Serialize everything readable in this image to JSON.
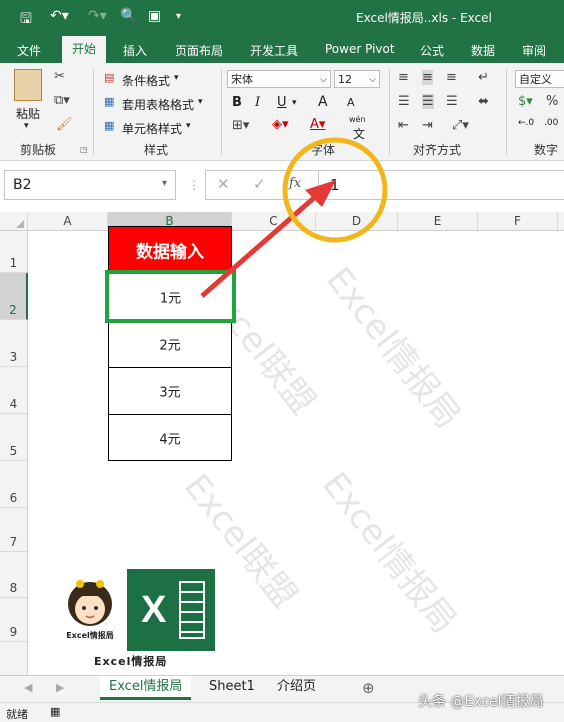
{
  "titlebar": {
    "title": "Excel情报局..xls  -  Excel"
  },
  "tabs": [
    "文件",
    "开始",
    "插入",
    "页面布局",
    "开发工具",
    "Power Pivot",
    "公式",
    "数据",
    "审阅"
  ],
  "ribbon": {
    "clipboard": {
      "paste": "粘贴",
      "label": "剪贴板"
    },
    "styles": {
      "conditional": "条件格式",
      "table_format": "套用表格格式",
      "cell_style": "单元格样式",
      "label": "样式"
    },
    "font": {
      "name": "宋体",
      "size": "12",
      "bold": "B",
      "italic": "I",
      "underline": "U",
      "grow": "A",
      "shrink": "A",
      "wen": "wén",
      "label": "字体"
    },
    "alignment": {
      "label": "对齐方式"
    },
    "number": {
      "format": "自定义",
      "label": "数字"
    }
  },
  "formula_bar": {
    "name_box": "B2",
    "fx": "fx",
    "value": "1"
  },
  "columns": [
    "A",
    "B",
    "C",
    "D",
    "E",
    "F"
  ],
  "rows": [
    "1",
    "2",
    "3",
    "4",
    "5",
    "6",
    "7",
    "8",
    "9"
  ],
  "cells": {
    "header": "数据输入",
    "values": [
      "1元",
      "2元",
      "3元",
      "4元"
    ]
  },
  "watermarks": [
    "Excel情报局",
    "Excel联盟",
    "Excel情报局",
    "Excel联盟"
  ],
  "logo": {
    "badge": "Excel情报局",
    "caption": "Excel情报局"
  },
  "sheets": [
    "Excel情报局",
    "Sheet1",
    "介绍页"
  ],
  "status": {
    "ready": "就绪"
  },
  "footer_watermark": "头条 @Excel情报局"
}
